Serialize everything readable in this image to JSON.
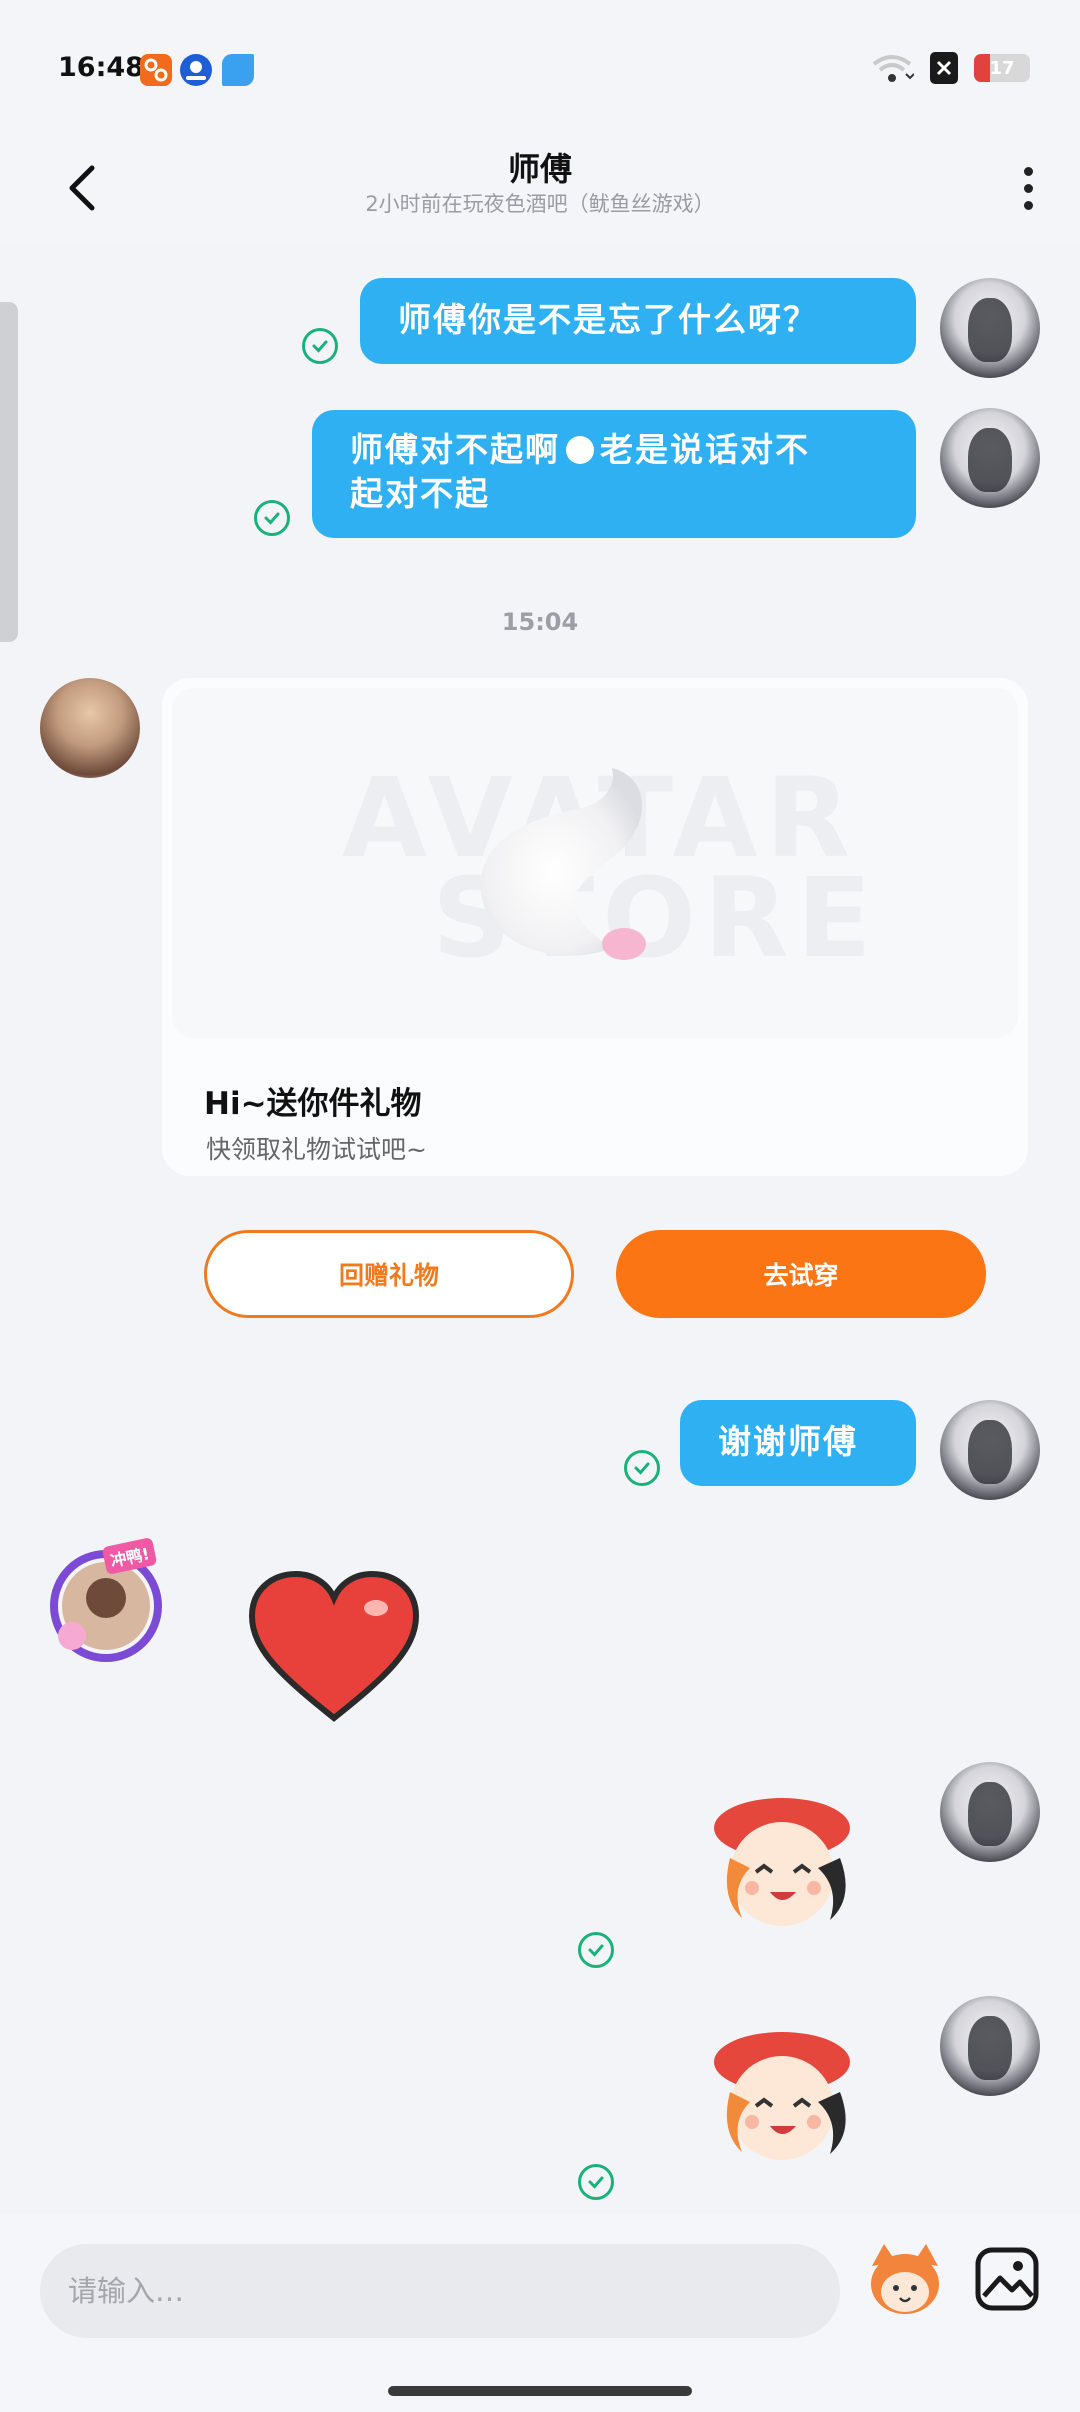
{
  "status_bar": {
    "time": "16:48",
    "battery": "17",
    "icons": [
      "app-notification-icon",
      "map-app-icon",
      "shield-app-icon",
      "wifi-icon",
      "close-box-icon",
      "battery-icon"
    ]
  },
  "header": {
    "title": "师傅",
    "subtitle": "2小时前在玩夜色酒吧（鱿鱼丝游戏）"
  },
  "messages": {
    "m1": "师傅你是不是忘了什么呀？",
    "m2_line1": "师傅对不起啊",
    "m2_line2": "老是说话对不",
    "m2_line3": "起对不起",
    "time_separator": "15:04",
    "thanks": "谢谢师傅"
  },
  "gift_card": {
    "watermark_line1": "AVATAR",
    "watermark_line2": "STORE",
    "title": "Hi~送你件礼物",
    "description": "快领取礼物试试吧~",
    "return_button": "回赠礼物",
    "try_button": "去试穿"
  },
  "avatar_frame_badge": "冲鸭!",
  "input": {
    "placeholder": "请输入…"
  },
  "colors": {
    "bubble": "#2fb0f2",
    "accent": "#fb7514",
    "check": "#1bb27a"
  }
}
